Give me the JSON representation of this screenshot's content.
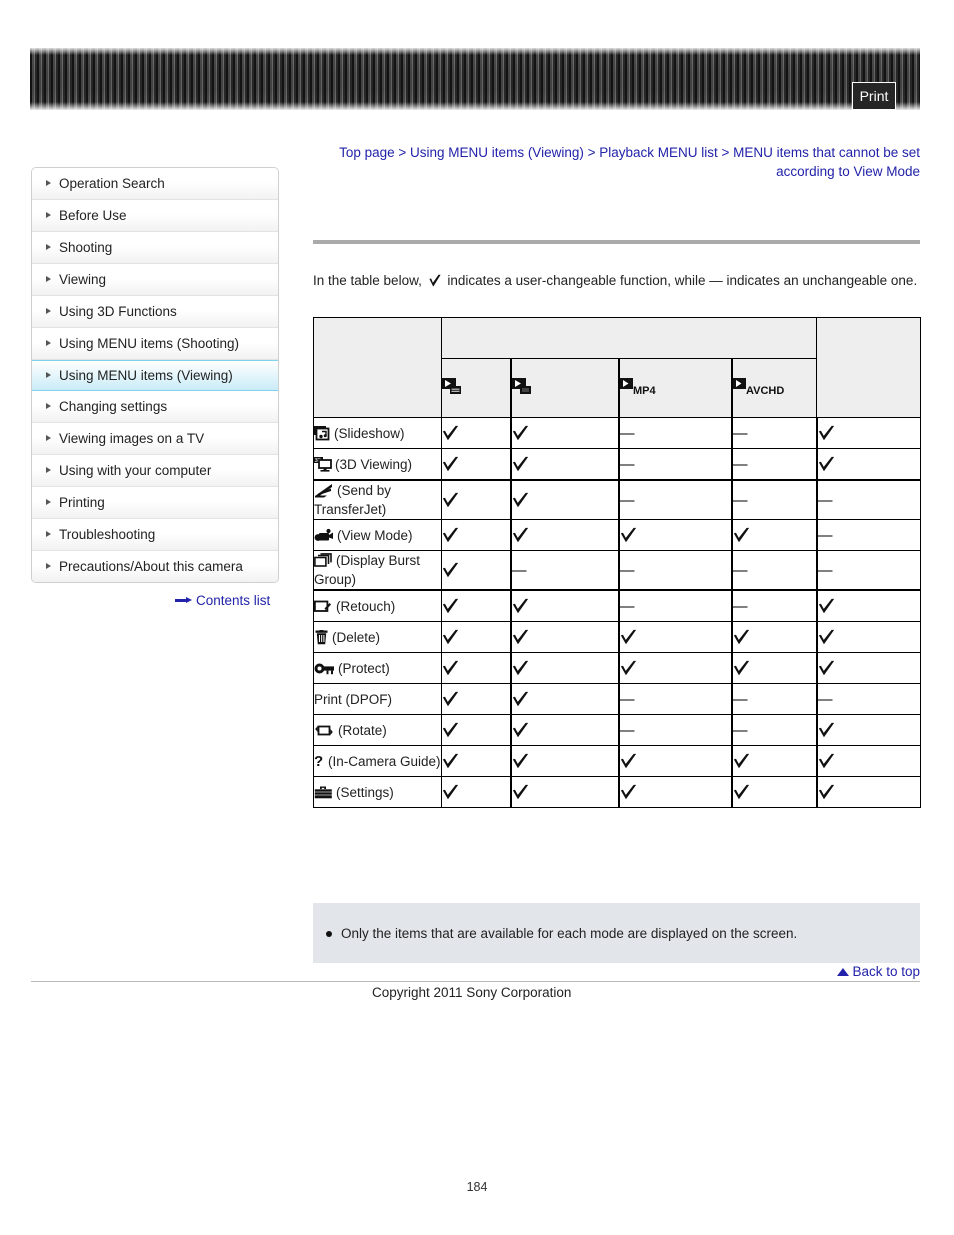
{
  "toolbar": {
    "print_label": "Print"
  },
  "breadcrumb": {
    "items": [
      "Top page",
      "Using MENU items (Viewing)",
      "Playback MENU list",
      "MENU items that cannot be set according to View Mode"
    ],
    "separator": ">"
  },
  "sidebar": {
    "items": [
      {
        "label": "Operation Search",
        "active": false
      },
      {
        "label": "Before Use",
        "active": false
      },
      {
        "label": "Shooting",
        "active": false
      },
      {
        "label": "Viewing",
        "active": false
      },
      {
        "label": "Using 3D Functions",
        "active": false
      },
      {
        "label": "Using MENU items (Shooting)",
        "active": false
      },
      {
        "label": "Using MENU items (Viewing)",
        "active": true
      },
      {
        "label": "Changing settings",
        "active": false
      },
      {
        "label": "Viewing images on a TV",
        "active": false
      },
      {
        "label": "Using with your computer",
        "active": false
      },
      {
        "label": "Printing",
        "active": false
      },
      {
        "label": "Troubleshooting",
        "active": false
      },
      {
        "label": "Precautions/About this camera",
        "active": false
      }
    ],
    "contents_link": "Contents list"
  },
  "main": {
    "intro_before": "In the table below,",
    "intro_after": "indicates a user-changeable function, while — indicates an unchangeable one."
  },
  "chart_data": {
    "type": "table",
    "title": "MENU items that cannot be set according to View Mode",
    "column_headers": [
      "",
      "Folder View (Still)",
      "Date View",
      "MP4",
      "AVCHD",
      ""
    ],
    "column_icons": [
      "",
      "playback-folder-still-icon",
      "playback-date-icon",
      "playback-mp4-icon",
      "playback-avchd-icon",
      ""
    ],
    "row_header_label": "",
    "rows": [
      {
        "icon": "slideshow-icon",
        "label": "(Slideshow)",
        "values": [
          "check",
          "check",
          "dash",
          "dash",
          "check"
        ]
      },
      {
        "icon": "3d-viewing-icon",
        "label": "(3D Viewing)",
        "values": [
          "check",
          "check",
          "dash",
          "dash",
          "check"
        ]
      },
      {
        "icon": "transferjet-icon",
        "label": "(Send by TransferJet)",
        "values": [
          "check",
          "check",
          "dash",
          "dash",
          "dash"
        ]
      },
      {
        "icon": "view-mode-icon",
        "label": "(View Mode)",
        "values": [
          "check",
          "check",
          "check",
          "check",
          "dash"
        ]
      },
      {
        "icon": "display-burst-icon",
        "label": "(Display Burst Group)",
        "values": [
          "check",
          "dash",
          "dash",
          "dash",
          "dash"
        ]
      },
      {
        "icon": "retouch-icon",
        "label": "(Retouch)",
        "values": [
          "check",
          "check",
          "dash",
          "dash",
          "check"
        ]
      },
      {
        "icon": "delete-icon",
        "label": "(Delete)",
        "values": [
          "check",
          "check",
          "check",
          "check",
          "check"
        ]
      },
      {
        "icon": "protect-key-icon",
        "label": "(Protect)",
        "values": [
          "check",
          "check",
          "check",
          "check",
          "check"
        ]
      },
      {
        "icon": "",
        "label": "Print (DPOF)",
        "values": [
          "check",
          "check",
          "dash",
          "dash",
          "dash"
        ]
      },
      {
        "icon": "rotate-icon",
        "label": "(Rotate)",
        "values": [
          "check",
          "check",
          "dash",
          "dash",
          "check"
        ]
      },
      {
        "icon": "in-camera-guide-icon",
        "label": "(In-Camera Guide)",
        "values": [
          "check",
          "check",
          "check",
          "check",
          "check"
        ]
      },
      {
        "icon": "settings-toolbox-icon",
        "label": "(Settings)",
        "values": [
          "check",
          "check",
          "check",
          "check",
          "check"
        ]
      }
    ],
    "legend": {
      "check": "user-changeable",
      "dash": "— unchangeable"
    }
  },
  "note": {
    "bullet": "Only the items that are available for each mode are displayed on the screen."
  },
  "footer": {
    "back_to_top": "Back to top",
    "copyright": "Copyright 2011 Sony Corporation",
    "page_number": "184"
  },
  "colors": {
    "link": "#2222aa",
    "active_highlight": "#c9ecf7",
    "note_bg": "#e2e5e9"
  }
}
